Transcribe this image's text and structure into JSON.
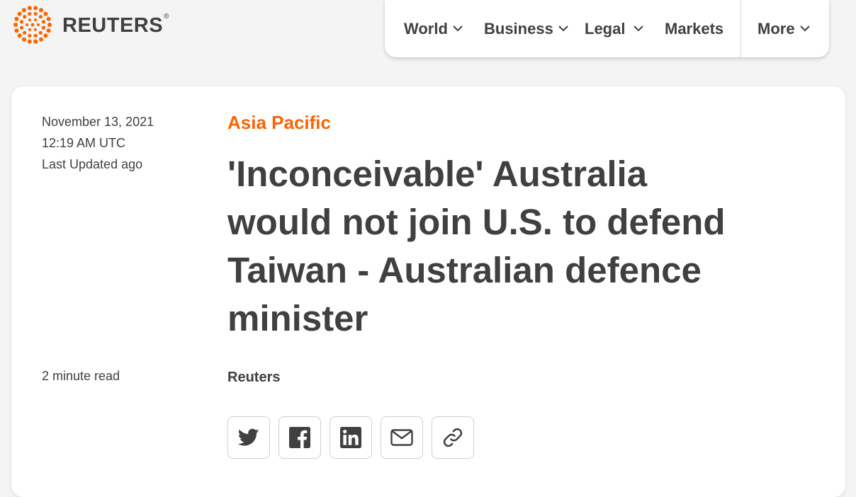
{
  "brand": {
    "name": "REUTERS",
    "reg_mark": "®",
    "accent": "#fa6400"
  },
  "nav": {
    "items": [
      {
        "label": "World",
        "dropdown": true
      },
      {
        "label": "Business",
        "dropdown": true
      },
      {
        "label": "Legal",
        "dropdown": true
      },
      {
        "label": "Markets",
        "dropdown": false
      },
      {
        "label": "More",
        "dropdown": true
      }
    ]
  },
  "article": {
    "date": "November 13, 2021",
    "time": "12:19 AM UTC",
    "updated": "Last Updated ago",
    "read_time": "2 minute read",
    "section": "Asia Pacific",
    "headline": "'Inconceivable' Australia would not join U.S. to defend Taiwan - Australian defence minister",
    "byline": "Reuters"
  },
  "share": {
    "buttons": [
      "twitter-icon",
      "facebook-icon",
      "linkedin-icon",
      "email-icon",
      "link-icon"
    ]
  }
}
